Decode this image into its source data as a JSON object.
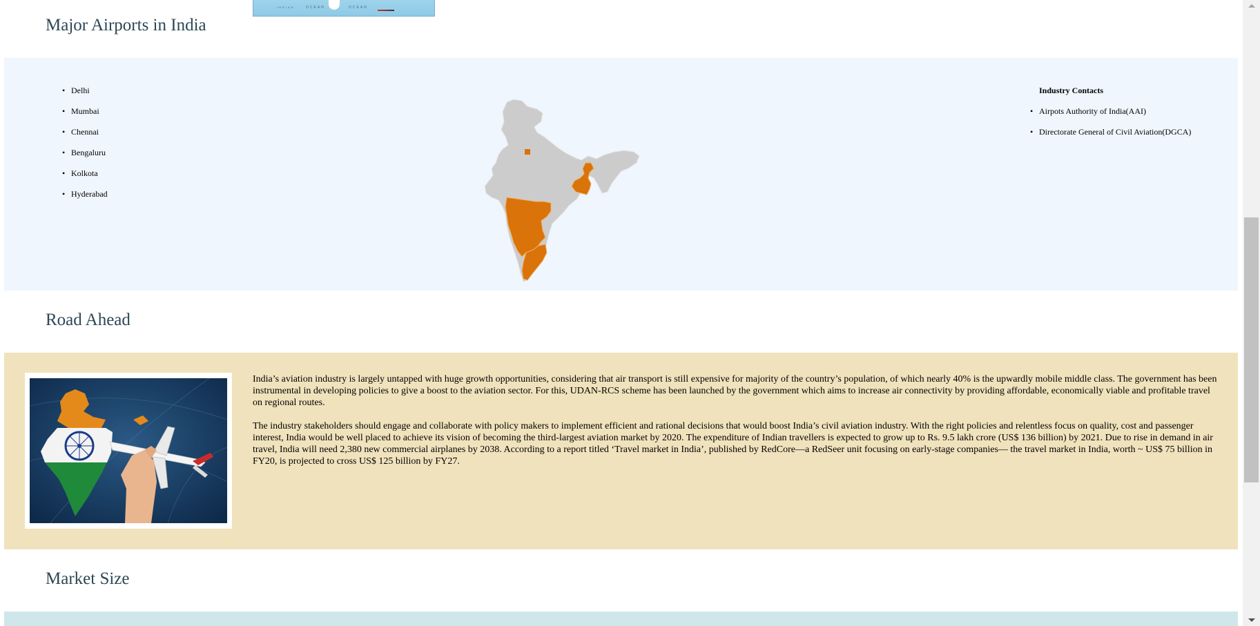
{
  "colors": {
    "heading": "#2c4754",
    "airports_band": "#eff6fd",
    "road_band": "#f0e2bc",
    "market_band": "#cfe7ea",
    "map_land": "#cccccc",
    "map_highlight": "#d9730a"
  },
  "sections": {
    "airports_heading": "Major Airports in India",
    "road_heading": "Road Ahead",
    "market_heading": "Market Size"
  },
  "airports": {
    "cities": [
      "Delhi",
      "Mumbai",
      "Chennai",
      "Bengaluru",
      "Kolkota",
      "Hyderabad"
    ],
    "contacts_title": "Industry Contacts",
    "contacts": [
      "Airpots Authority of India(AAI)",
      "Directorate General of Civil Aviation(DGCA)"
    ]
  },
  "road_ahead": {
    "paragraphs": [
      "India’s aviation industry is largely untapped with huge growth opportunities, considering that air transport is still expensive for majority of the country’s population, of which nearly 40% is the upwardly mobile middle class. The government has been instrumental in developing policies to give a boost to the aviation sector. For this, UDAN-RCS scheme has been launched by the government which aims to increase air connectivity by providing affordable, economically viable and profitable travel on regional routes.",
      "The industry stakeholders should engage and collaborate with policy makers to implement efficient and rational decisions that would boost India’s civil aviation industry. With the right policies and relentless focus on quality, cost and passenger interest, India would be well placed to achieve its vision of becoming the third-largest aviation market by 2020. The expenditure of Indian travellers is expected to grow up to Rs. 9.5 lakh crore (US$ 136 billion) by 2021. Due to rise in demand in air travel, India will need 2,380 new commercial airplanes by 2038. According to a report titled ‘Travel market in India’, published by RedCore—a RedSeer unit focusing on early-stage companies— the travel market in India, worth ~ US$ 75 billion in FY20, is projected to cross US$ 125 billion by FY27."
    ]
  },
  "top_map_labels": [
    "INDIAN",
    "OCEAN",
    "OCEAN"
  ]
}
